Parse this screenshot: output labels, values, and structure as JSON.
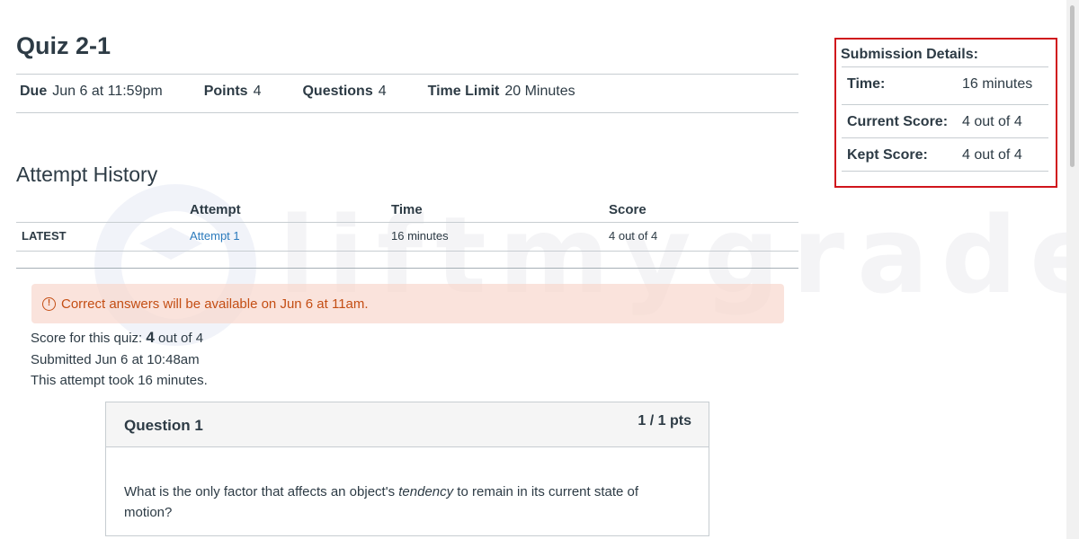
{
  "quiz": {
    "title": "Quiz 2-1",
    "details": [
      {
        "label": "Due",
        "value": "Jun 6 at 11:59pm"
      },
      {
        "label": "Points",
        "value": "4"
      },
      {
        "label": "Questions",
        "value": "4"
      },
      {
        "label": "Time Limit",
        "value": "20 Minutes"
      }
    ]
  },
  "attempt_history": {
    "heading": "Attempt History",
    "columns": [
      "Attempt",
      "Time",
      "Score"
    ],
    "rows": [
      {
        "tag": "LATEST",
        "attempt": "Attempt 1",
        "time": "16 minutes",
        "score": "4 out of 4"
      }
    ]
  },
  "alert": {
    "icon": "warning-circle-icon",
    "text": "Correct answers will be available on Jun 6 at 11am.",
    "color": "#c44e14"
  },
  "summary": {
    "score_prefix": "Score for this quiz:",
    "score_value": "4",
    "score_suffix": "out of 4",
    "submitted": "Submitted Jun 6 at 10:48am",
    "duration": "This attempt took 16 minutes."
  },
  "question": {
    "title": "Question 1",
    "points": "1 / 1 pts",
    "text_before": "What is the only factor that affects an object's ",
    "text_emphasis": "tendency",
    "text_after": " to remain in its current state of motion?"
  },
  "submission_details": {
    "heading": "Submission Details:",
    "rows": [
      {
        "label": "Time:",
        "value": "16 minutes"
      },
      {
        "label": "Current Score:",
        "value": "4 out of 4"
      },
      {
        "label": "Kept Score:",
        "value": "4 out of 4"
      }
    ],
    "highlight_color": "#d0151c"
  },
  "watermark": {
    "text": "liftmygrades"
  }
}
